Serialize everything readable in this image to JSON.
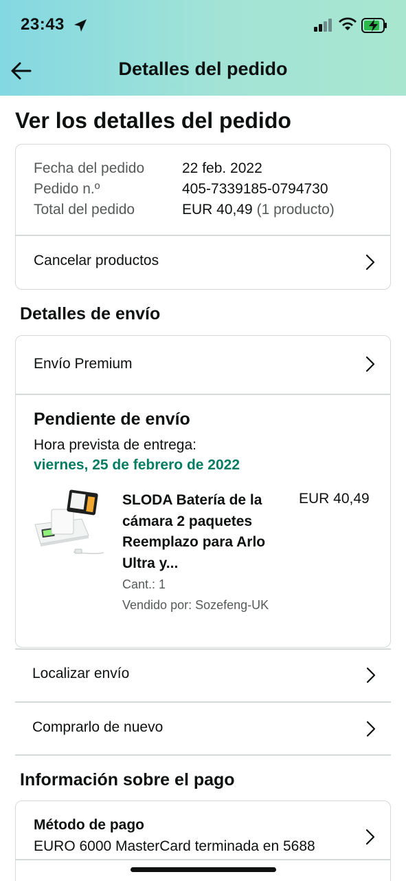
{
  "status_bar": {
    "time": "23:43"
  },
  "header": {
    "title": "Detalles del pedido"
  },
  "page": {
    "title": "Ver los detalles del pedido"
  },
  "order_summary": {
    "date_label": "Fecha del pedido",
    "date_value": "22 feb. 2022",
    "number_label": "Pedido n.º",
    "number_value": "405-7339185-0794730",
    "total_label": "Total del pedido",
    "total_value": "EUR 40,49",
    "total_count": "(1 producto)",
    "cancel_label": "Cancelar productos"
  },
  "shipping": {
    "section_title": "Detalles de envío",
    "premium_label": "Envío Premium",
    "status_title": "Pendiente de envío",
    "eta_label": "Hora prevista de entrega:",
    "eta_date": "viernes, 25 de febrero de 2022",
    "product": {
      "name_lines": [
        "SLODA Batería de la",
        "cámara 2 paquetes",
        "Reemplazo para Arlo",
        "Ultra y..."
      ],
      "price": "EUR 40,49",
      "qty": "Cant.: 1",
      "seller": "Vendido por: Sozefeng-UK"
    },
    "track_label": "Localizar envío",
    "rebuy_label": "Comprarlo de nuevo"
  },
  "payment": {
    "section_title": "Información sobre el pago",
    "method_title": "Método de pago",
    "method_value": "EURO 6000 MasterCard terminada en 5688"
  },
  "colors": {
    "accent_green": "#067d62",
    "header_gradient_start": "#84d8e2",
    "header_gradient_end": "#a8e6cf"
  }
}
